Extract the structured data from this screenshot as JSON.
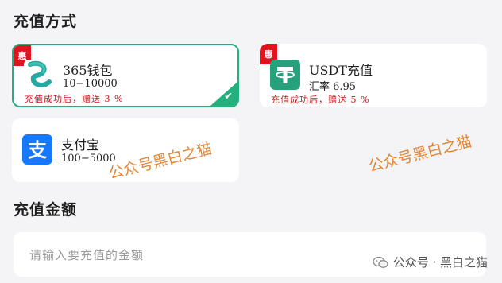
{
  "sections": {
    "payment_method_title": "充值方式",
    "amount_title": "充值金额"
  },
  "methods": [
    {
      "name": "365钱包",
      "range": "10−10000",
      "promo_tag": "惠",
      "promo_text": "充值成功后，赠送 3 %",
      "icon": "wallet-s-icon",
      "selected": true
    },
    {
      "name": "USDT充值",
      "range": "汇率 6.95",
      "promo_tag": "惠",
      "promo_text": "充值成功后，赠送 5 %",
      "icon": "tether-icon",
      "selected": false
    },
    {
      "name": "支付宝",
      "range": "100−5000",
      "icon": "alipay-icon",
      "selected": false
    }
  ],
  "amount_input": {
    "placeholder": "请输入要充值的金额"
  },
  "watermarks": [
    "公众号黑白之猫",
    "公众号黑白之猫"
  ],
  "footer": {
    "text": "公众号 · 黑白之猫"
  },
  "colors": {
    "accent_green": "#22b07d",
    "promo_red": "#e0141e",
    "watermark_orange": "#e07a1e"
  }
}
